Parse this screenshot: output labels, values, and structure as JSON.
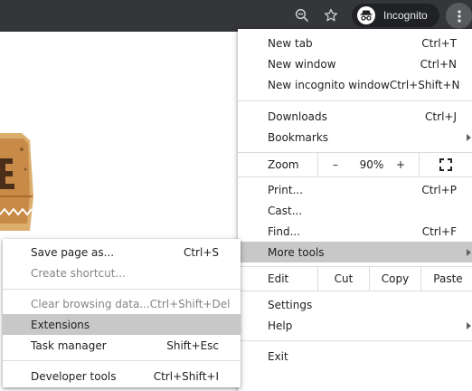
{
  "toolbar": {
    "incognito_label": "Incognito",
    "icons": [
      "zoom-out-icon",
      "star-icon",
      "incognito-icon",
      "kebab-menu-icon"
    ],
    "bg_color": "#35363a"
  },
  "menu": {
    "new_tab": {
      "label": "New tab",
      "shortcut": "Ctrl+T"
    },
    "new_window": {
      "label": "New window",
      "shortcut": "Ctrl+N"
    },
    "new_incognito": {
      "label": "New incognito window",
      "shortcut": "Ctrl+Shift+N"
    },
    "downloads": {
      "label": "Downloads",
      "shortcut": "Ctrl+J"
    },
    "bookmarks": {
      "label": "Bookmarks"
    },
    "zoom": {
      "label": "Zoom",
      "minus": "–",
      "value": "90%",
      "plus": "+"
    },
    "print": {
      "label": "Print...",
      "shortcut": "Ctrl+P"
    },
    "cast": {
      "label": "Cast..."
    },
    "find": {
      "label": "Find...",
      "shortcut": "Ctrl+F"
    },
    "more_tools": {
      "label": "More tools"
    },
    "edit": {
      "label": "Edit",
      "cut": "Cut",
      "copy": "Copy",
      "paste": "Paste"
    },
    "settings": {
      "label": "Settings"
    },
    "help": {
      "label": "Help"
    },
    "exit": {
      "label": "Exit"
    }
  },
  "submenu": {
    "save_page": {
      "label": "Save page as...",
      "shortcut": "Ctrl+S"
    },
    "create_shortcut": {
      "label": "Create shortcut..."
    },
    "clear_browsing": {
      "label": "Clear browsing data...",
      "shortcut": "Ctrl+Shift+Del"
    },
    "extensions": {
      "label": "Extensions"
    },
    "task_manager": {
      "label": "Task manager",
      "shortcut": "Shift+Esc"
    },
    "developer_tools": {
      "label": "Developer tools",
      "shortcut": "Ctrl+Shift+I"
    }
  },
  "highlight_color": "#c8c8c8"
}
